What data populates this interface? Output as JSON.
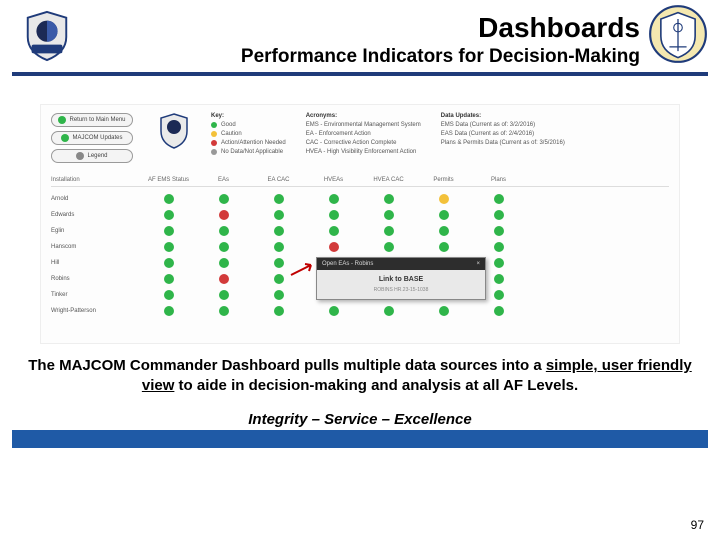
{
  "header": {
    "title": "Dashboards",
    "subtitle": "Performance Indicators for Decision-Making"
  },
  "dashboard": {
    "buttons": {
      "return": "Return to Main Menu",
      "updates": "MAJCOM Updates",
      "legend": "Legend"
    },
    "key": {
      "heading": "Key:",
      "good": "Good",
      "caution": "Caution",
      "action": "Action/Attention Needed",
      "nodata": "No Data/Not Applicable"
    },
    "acronyms": {
      "heading": "Acronyms:",
      "l1": "EMS - Environmental Management System",
      "l2": "EA - Enforcement Action",
      "l3": "CAC - Corrective Action Complete",
      "l4": "HVEA - High Visibility Enforcement Action"
    },
    "updates": {
      "heading": "Data Updates:",
      "l1": "EMS Data (Current as of: 3/2/2016)",
      "l2": "EAS Data (Current as of: 2/4/2016)",
      "l3": "Plans & Permits Data (Current as of: 3/5/2016)"
    },
    "columns": {
      "c0": "Installation",
      "c1": "AF EMS Status",
      "c2": "EAs",
      "c3": "EA CAC",
      "c4": "HVEAs",
      "c5": "HVEA CAC",
      "c6": "Permits",
      "c7": "Plans"
    },
    "rows": {
      "r0": "Arnold",
      "r1": "Edwards",
      "r2": "Eglin",
      "r3": "Hanscom",
      "r4": "Hill",
      "r5": "Robins",
      "r6": "Tinker",
      "r7": "Wright-Patterson"
    },
    "popup": {
      "bar": "Open EAs - Robins",
      "close": "×",
      "title": "Link to BASE",
      "sub": "ROBINS  HR.23-15-1038"
    }
  },
  "caption": {
    "part1": "The MAJCOM Commander Dashboard pulls multiple data sources into a ",
    "ul": "simple, user friendly view",
    "part2": " to aide in decision-making and analysis at all AF Levels."
  },
  "motto": "Integrity – Service – Excellence",
  "page_number": "97"
}
